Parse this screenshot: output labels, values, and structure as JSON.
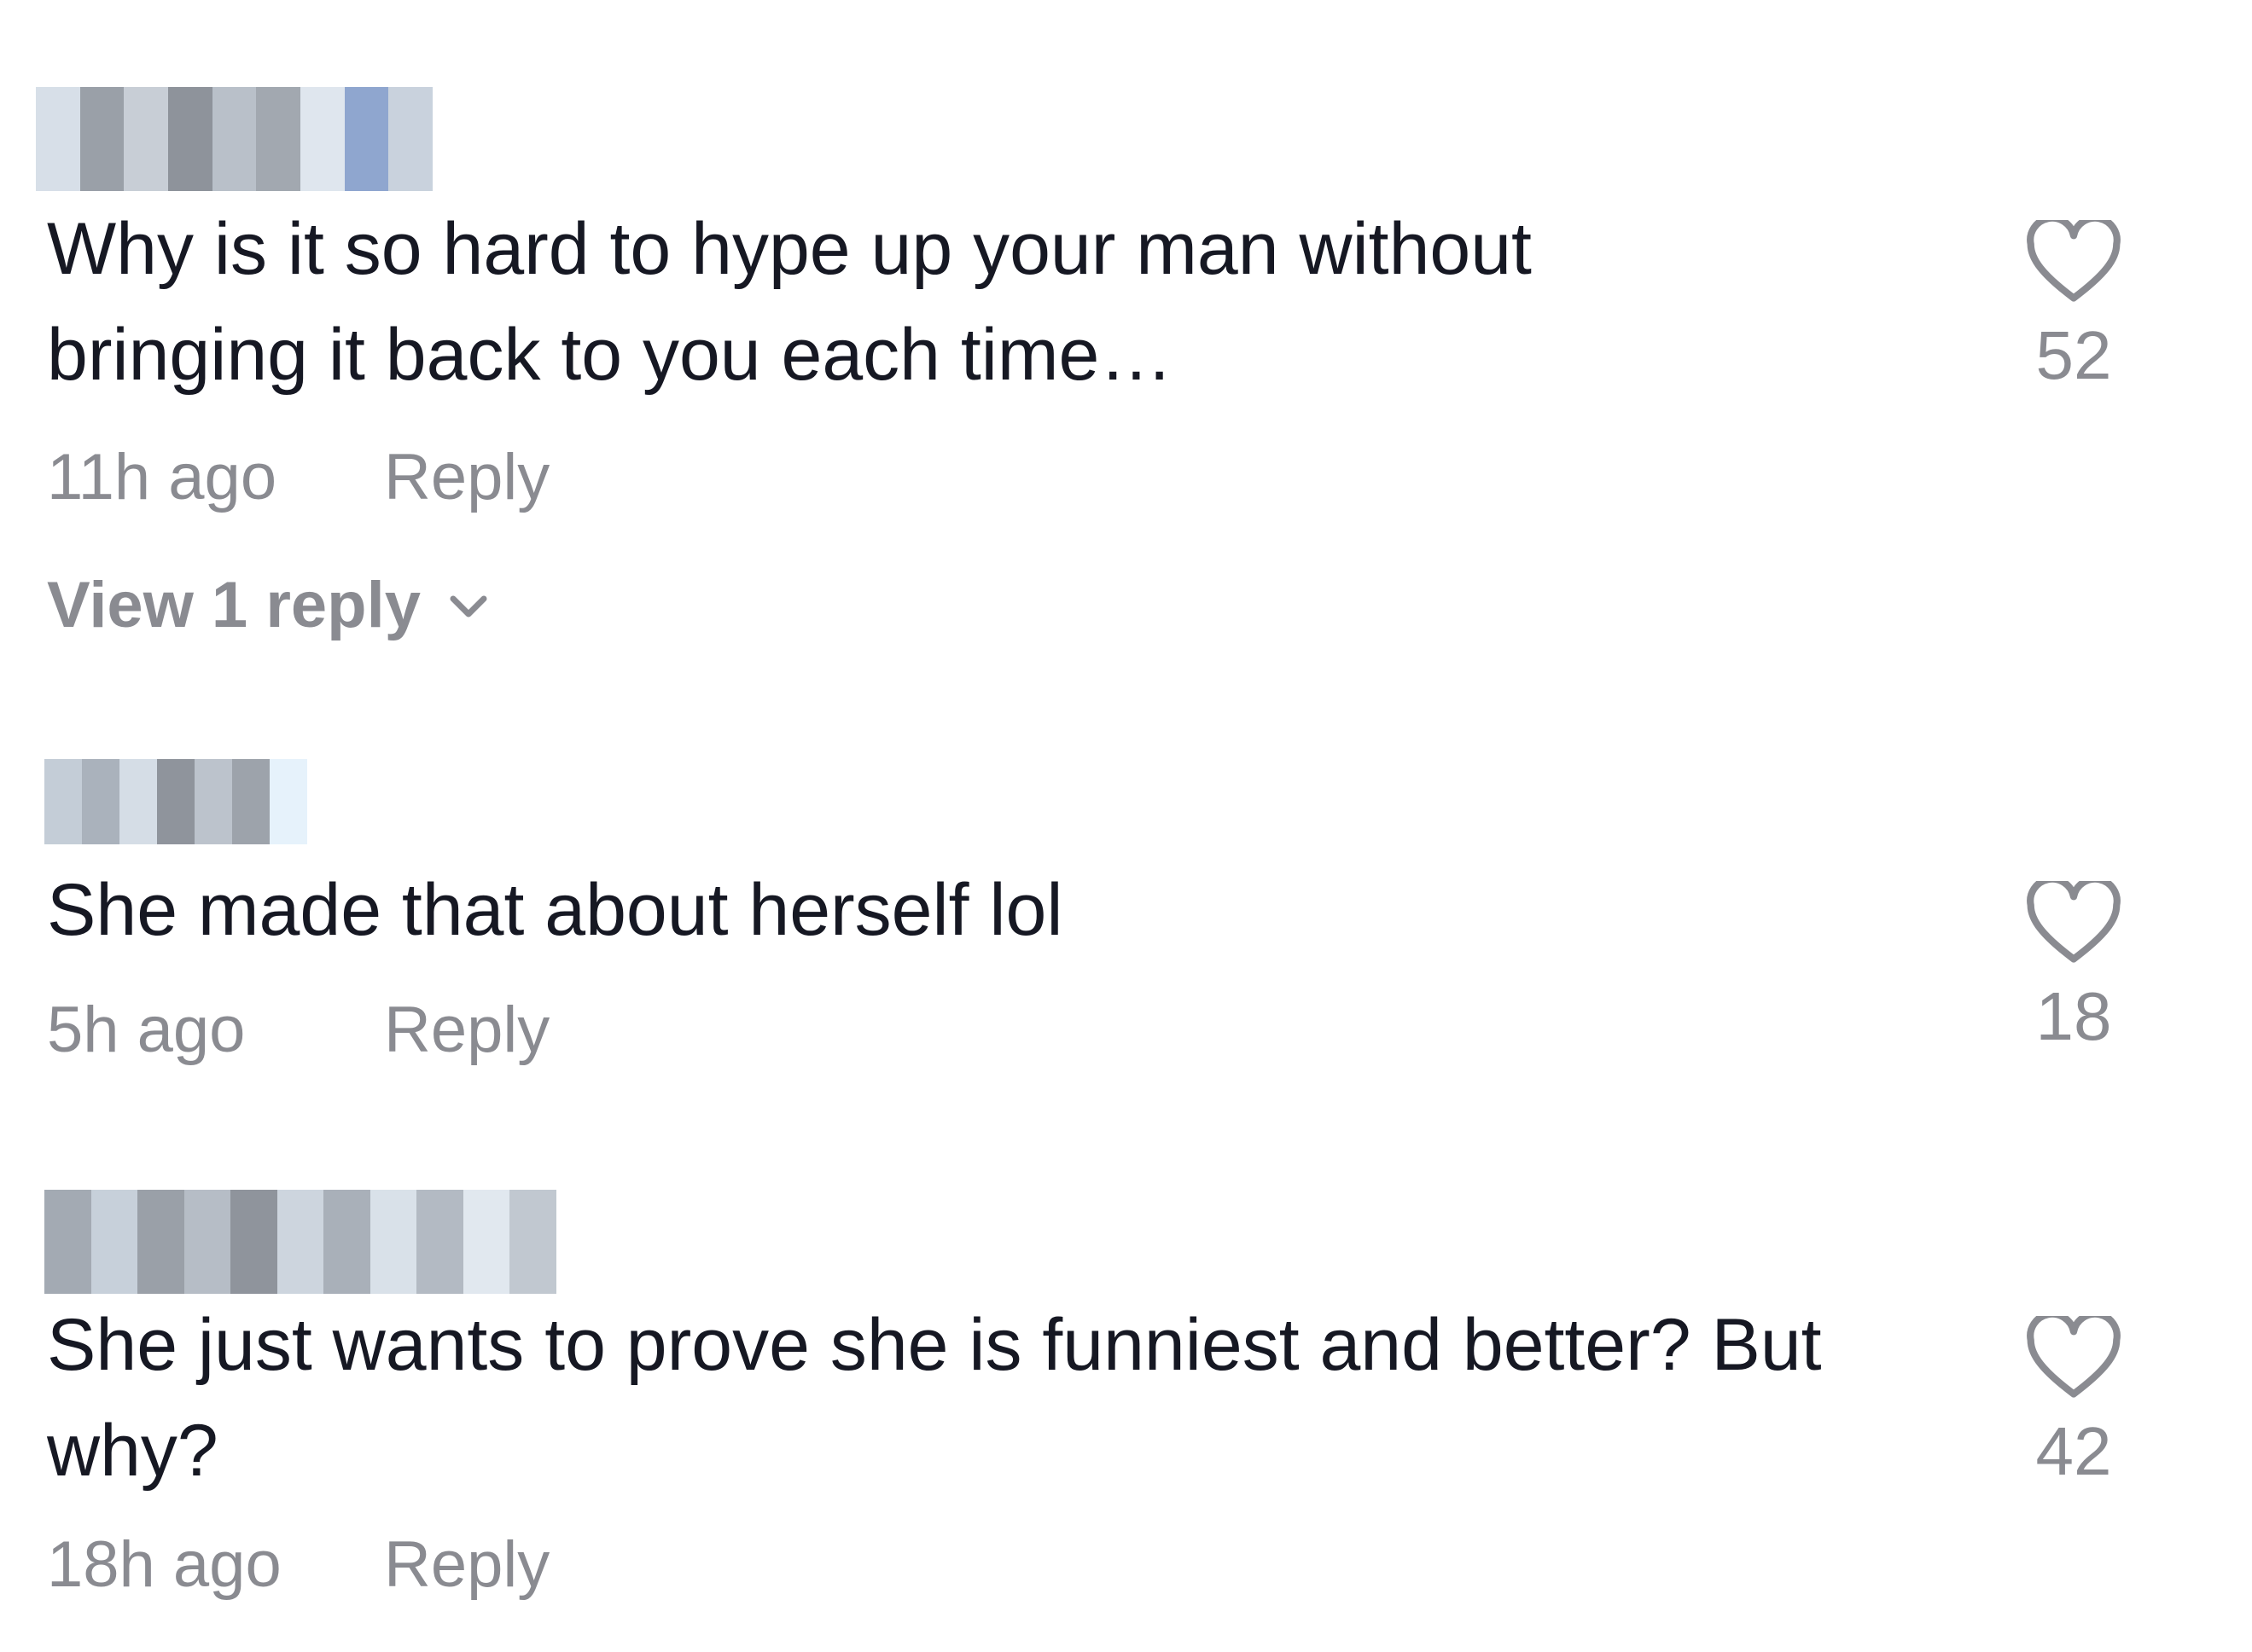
{
  "comments": [
    {
      "text": "Why is it so hard to hype up your man without bringing it back to you each time…",
      "time": "11h ago",
      "reply_label": "Reply",
      "likes": "52",
      "view_replies": "View 1 reply",
      "username_blurred": true
    },
    {
      "text": "She made that about herself lol",
      "time": "5h ago",
      "reply_label": "Reply",
      "likes": "18",
      "username_blurred": true
    },
    {
      "text": "She just wants to prove she is funniest and better? But why?",
      "time": "18h ago",
      "reply_label": "Reply",
      "likes": "42",
      "username_blurred": true
    }
  ],
  "icons": {
    "like": "heart-outline-icon",
    "expand": "chevron-down-icon"
  },
  "colors": {
    "text": "#161823",
    "secondary": "#8a8b91",
    "heart_stroke": "#8a8b91",
    "background": "#ffffff"
  }
}
